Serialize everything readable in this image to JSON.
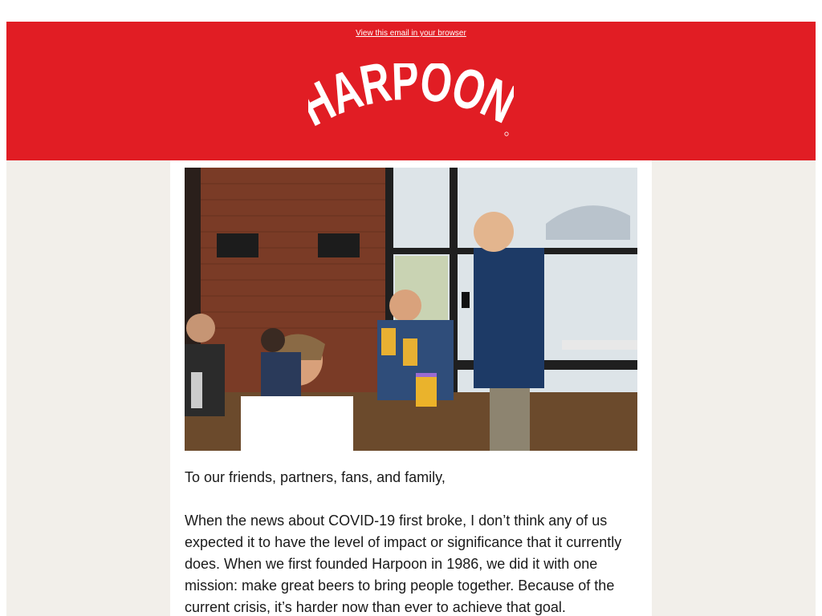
{
  "header": {
    "view_in_browser": "View this email in your browser",
    "logo_text": "HARPOON",
    "brand_color": "#e11d24"
  },
  "hero_image": {
    "description_icon": "photo-toast-icon"
  },
  "body": {
    "greeting": "To our friends, partners, fans, and family,",
    "paragraph1": "When the news about COVID-19 first broke, I don’t think any of us expected it to have the level of impact or significance that it currently does. When we first founded Harpoon in 1986, we did it with one mission: make great beers to bring people together. Because of the current crisis, it’s harder now than ever to achieve that goal."
  }
}
